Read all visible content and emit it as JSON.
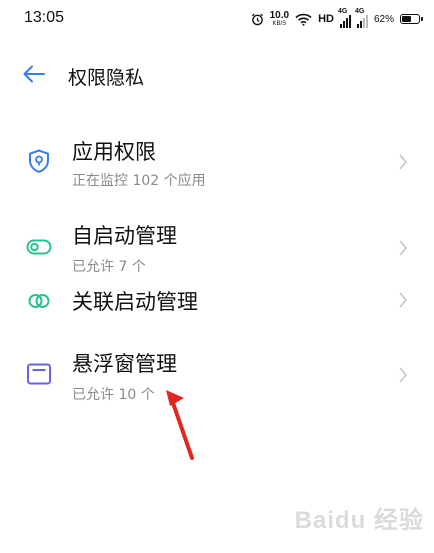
{
  "status_bar": {
    "time": "13:05",
    "net_speed_value": "10.0",
    "net_speed_unit": "KB/S",
    "hd": "HD",
    "signal1_tag": "4G",
    "signal2_tag": "4G",
    "battery_percent": "62%",
    "battery_level": 0.62
  },
  "header": {
    "title": "权限隐私"
  },
  "items": [
    {
      "label": "应用权限",
      "sub": "正在监控 102 个应用",
      "icon": "shield-location-icon"
    },
    {
      "label": "自启动管理",
      "sub": "已允许 7 个",
      "icon": "toggle-icon"
    },
    {
      "label": "关联启动管理",
      "sub": "",
      "icon": "link-icon"
    },
    {
      "label": "悬浮窗管理",
      "sub": "已允许 10 个",
      "icon": "window-icon"
    }
  ],
  "watermark": "Baidu 经验",
  "colors": {
    "accent": "#3a7bf0",
    "green": "#27c48a",
    "purple": "#6a63e0",
    "annotation_red": "#e02525"
  }
}
